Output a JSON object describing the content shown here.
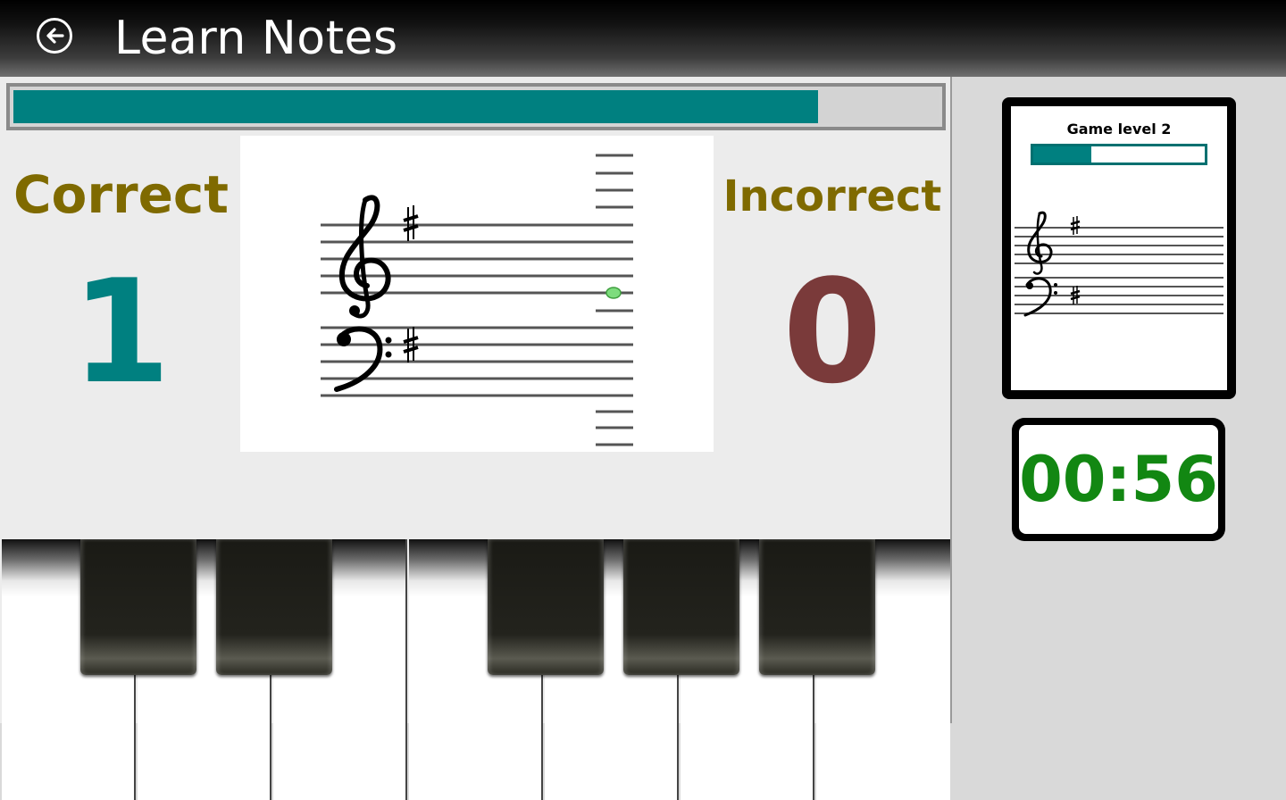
{
  "header": {
    "title": "Learn Notes",
    "back_icon": "arrow-left-icon"
  },
  "progress": {
    "fraction": 0.87,
    "color": "#008080"
  },
  "score": {
    "correct_label": "Correct",
    "correct_value": "1",
    "incorrect_label": "Incorrect",
    "incorrect_value": "0",
    "correct_color": "#008080",
    "incorrect_color": "#7a3a3a",
    "label_color": "#7f6a00"
  },
  "staff": {
    "clefs": [
      "treble-clef-icon",
      "bass-clef-icon"
    ],
    "key_signature": "sharp-icon",
    "note_color": "#7ddc7d"
  },
  "level_card": {
    "title": "Game level  2",
    "progress_fraction": 0.34
  },
  "timer": {
    "value": "00:56",
    "color": "#128712"
  },
  "keyboard": {
    "white_keys": 7,
    "black_keys": 5
  }
}
